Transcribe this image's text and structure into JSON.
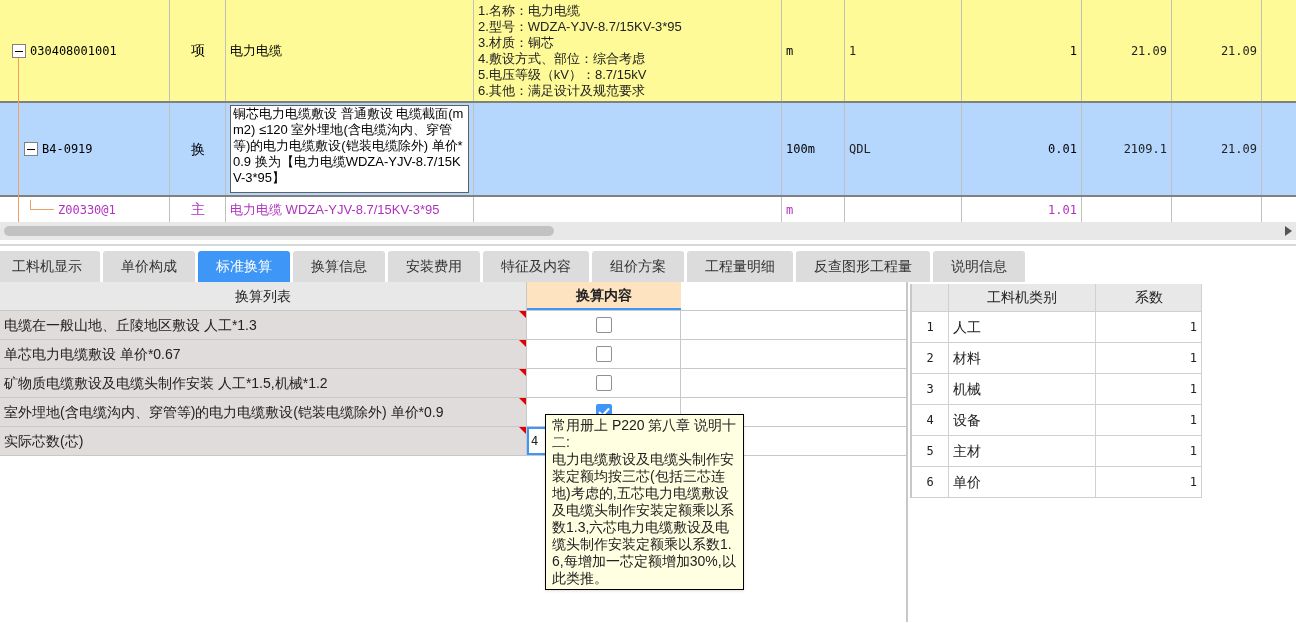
{
  "grid": {
    "rows": [
      {
        "kind": "item",
        "code": "030408001001",
        "type": "项",
        "name": "电力电缆",
        "features": [
          "1.名称：电力电缆",
          "2.型号：WDZA-YJV-8.7/15KV-3*95",
          "3.材质：铜芯",
          "4.敷设方式、部位：综合考虑",
          "5.电压等级（kV）：8.7/15kV",
          "6.其他：满足设计及规范要求"
        ],
        "unit": "m",
        "expression": "1",
        "quantity": "1",
        "unit_price": "21.09",
        "total": "21.09",
        "expanded": true
      },
      {
        "kind": "quota",
        "code": "B4-0919",
        "type": "换",
        "name": "铜芯电力电缆敷设 普通敷设 电缆截面(mm2) ≤120  室外埋地(含电缆沟内、穿管等)的电力电缆敷设(铠装电缆除外) 单价*0.9  换为【电力电缆WDZA-YJV-8.7/15KV-3*95】",
        "features": [],
        "unit": "100m",
        "expression": "QDL",
        "quantity": "0.01",
        "unit_price": "2109.1",
        "total": "21.09",
        "expanded": true
      },
      {
        "kind": "material",
        "code": "Z00330@1",
        "type": "主",
        "name": "电力电缆 WDZA-YJV-8.7/15KV-3*95",
        "features": [],
        "unit": "m",
        "expression": "",
        "quantity": "1.01",
        "unit_price": "",
        "total": ""
      }
    ]
  },
  "tabs": [
    {
      "label": "工料机显示",
      "selected": false
    },
    {
      "label": "单价构成",
      "selected": false
    },
    {
      "label": "标准换算",
      "selected": true
    },
    {
      "label": "换算信息",
      "selected": false
    },
    {
      "label": "安装费用",
      "selected": false
    },
    {
      "label": "特征及内容",
      "selected": false
    },
    {
      "label": "组价方案",
      "selected": false
    },
    {
      "label": "工程量明细",
      "selected": false
    },
    {
      "label": "反查图形工程量",
      "selected": false
    },
    {
      "label": "说明信息",
      "selected": false
    }
  ],
  "conversion": {
    "columns": [
      "换算列表",
      "换算内容"
    ],
    "rows": [
      {
        "kind": "checkbox",
        "label": "电缆在一般山地、丘陵地区敷设 人工*1.3",
        "checked": false
      },
      {
        "kind": "checkbox",
        "label": "单芯电力电缆敷设 单价*0.67",
        "checked": false
      },
      {
        "kind": "checkbox",
        "label": "矿物质电缆敷设及电缆头制作安装 人工*1.5,机械*1.2",
        "checked": false
      },
      {
        "kind": "checkbox",
        "label": "室外埋地(含电缆沟内、穿管等)的电力电缆敷设(铠装电缆除外) 单价*0.9",
        "checked": true
      },
      {
        "kind": "input",
        "label": "实际芯数(芯)",
        "value": "4"
      }
    ]
  },
  "tooltip": {
    "text": "常用册上 P220 第八章 说明十二:",
    "body": "电力电缆敷设及电缆头制作安装定额均按三芯(包括三芯连地)考虑的,五芯电力电缆敷设及电缆头制作安装定额乘以系数1.3,六芯电力电缆敷设及电缆头制作安装定额乘以系数1.6,每增加一芯定额增加30%,以此类推。"
  },
  "coefficients": {
    "columns": [
      "工料机类别",
      "系数"
    ],
    "rows": [
      {
        "index": "1",
        "category": "人工",
        "coefficient": "1"
      },
      {
        "index": "2",
        "category": "材料",
        "coefficient": "1"
      },
      {
        "index": "3",
        "category": "机械",
        "coefficient": "1"
      },
      {
        "index": "4",
        "category": "设备",
        "coefficient": "1"
      },
      {
        "index": "5",
        "category": "主材",
        "coefficient": "1"
      },
      {
        "index": "6",
        "category": "单价",
        "coefficient": "1"
      }
    ]
  }
}
